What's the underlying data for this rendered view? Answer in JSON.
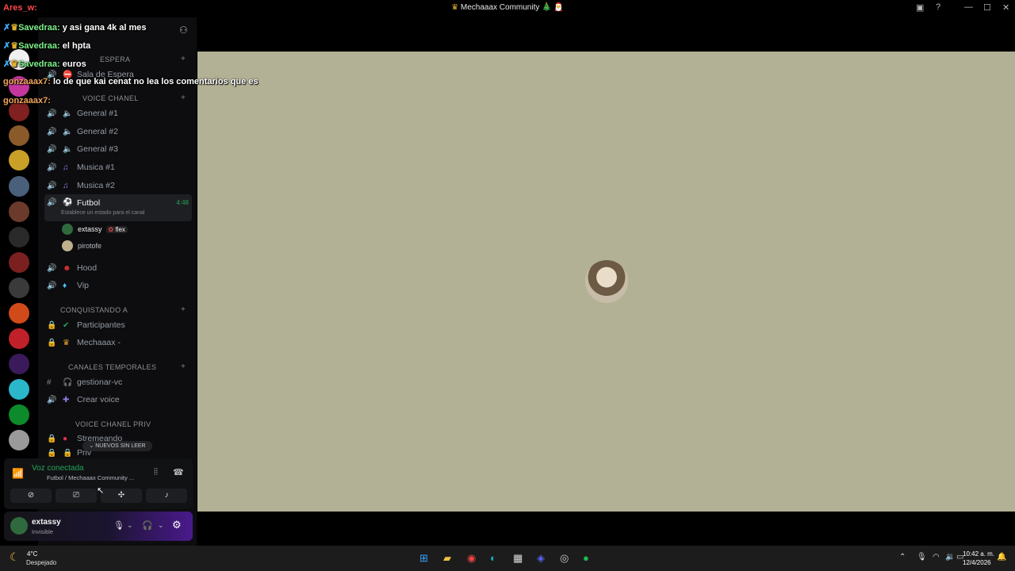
{
  "window": {
    "title": "Mechaaax Community 🎄 🎅",
    "left_icon": "crown-icon",
    "controls": [
      "inbox-icon",
      "help-icon",
      "minimize-icon",
      "maximize-icon",
      "close-icon"
    ]
  },
  "chat_overlay": [
    {
      "name": "Ares_w:",
      "text": "",
      "color": "red"
    },
    {
      "name": "Savedraa:",
      "text": "y asi gana 4k al mes",
      "color": "green"
    },
    {
      "name": "Savedraa:",
      "text": "el hpta",
      "color": "green"
    },
    {
      "name": "Savedraa:",
      "text": "euros",
      "color": "green"
    },
    {
      "name": "gonzaaax7:",
      "text": "lo de que kai cenat no lea los comentarios que es",
      "color": "orange"
    },
    {
      "name": "gonzaaax7:",
      "text": "",
      "color": "orange"
    }
  ],
  "sidebar": {
    "categories": [
      {
        "label": "ESPERA"
      },
      {
        "label": "VOICE CHANEL"
      },
      {
        "label": "CONQUISTANDO A"
      },
      {
        "label": "CANALES TEMPORALES"
      },
      {
        "label": "VOICE CHANEL PRIV"
      }
    ],
    "channels": [
      {
        "label": "Sala de Espera"
      },
      {
        "label": "General #1"
      },
      {
        "label": "General #2"
      },
      {
        "label": "General #3"
      },
      {
        "label": "Musica #1"
      },
      {
        "label": "Musica #2"
      },
      {
        "label": "Futbol",
        "timer": "4:48",
        "status_hint": "Establece un estado para el canal"
      },
      {
        "label": "Hood"
      },
      {
        "label": "Vip"
      },
      {
        "label": "Participantes"
      },
      {
        "label": "Mechaaax -"
      },
      {
        "label": "gestionar-vc"
      },
      {
        "label": "Crear voice"
      },
      {
        "label": "Stremeando"
      },
      {
        "label": "Priv"
      }
    ],
    "voice_users": [
      {
        "name": "extassy",
        "badge": "flex"
      },
      {
        "name": "pirotofe"
      }
    ],
    "new_unread": "NUEVOS SIN LEER"
  },
  "voice_panel": {
    "status": "Voz conectada",
    "location": "Futbol / Mechaaax Community ..."
  },
  "user_panel": {
    "name": "extassy",
    "status": "Invisible"
  },
  "taskbar": {
    "weather_temp": "4°C",
    "weather_desc": "Despejado",
    "time": "10:42 a. m.",
    "date": "12/4/2026"
  },
  "colors": {
    "stage_bg": "#b2b195",
    "voice_green": "#23a55a",
    "accent_purple": "#5b2bd1"
  }
}
